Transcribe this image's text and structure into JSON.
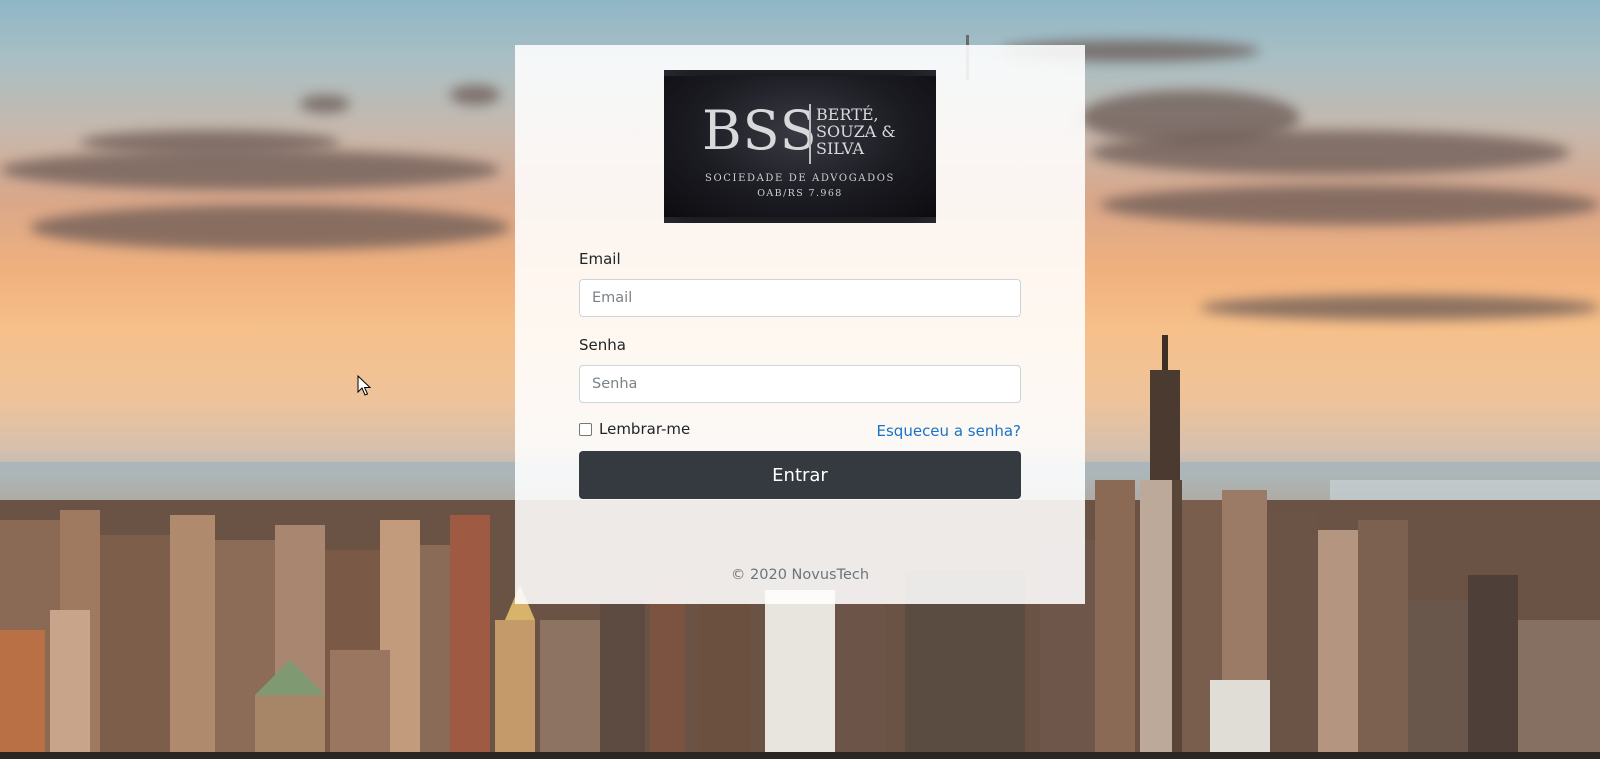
{
  "logo": {
    "mark": "BSS",
    "names": [
      "BERTÉ,",
      "SOUZA &",
      "SILVA"
    ],
    "subtitle": "SOCIEDADE DE ADVOGADOS",
    "registration": "OAB/RS 7.968"
  },
  "form": {
    "email_label": "Email",
    "email_placeholder": "Email",
    "email_value": "",
    "password_label": "Senha",
    "password_placeholder": "Senha",
    "password_value": "",
    "remember_label": "Lembrar-me",
    "remember_checked": false,
    "forgot_link": "Esqueceu a senha?",
    "submit_label": "Entrar"
  },
  "footer": {
    "copyright": "© 2020 NovusTech"
  },
  "colors": {
    "button_bg": "#343a40",
    "link": "#1a73c8",
    "card_bg": "rgba(255,255,255,0.88)"
  },
  "icons": {
    "cursor": "mouse-pointer-icon"
  }
}
